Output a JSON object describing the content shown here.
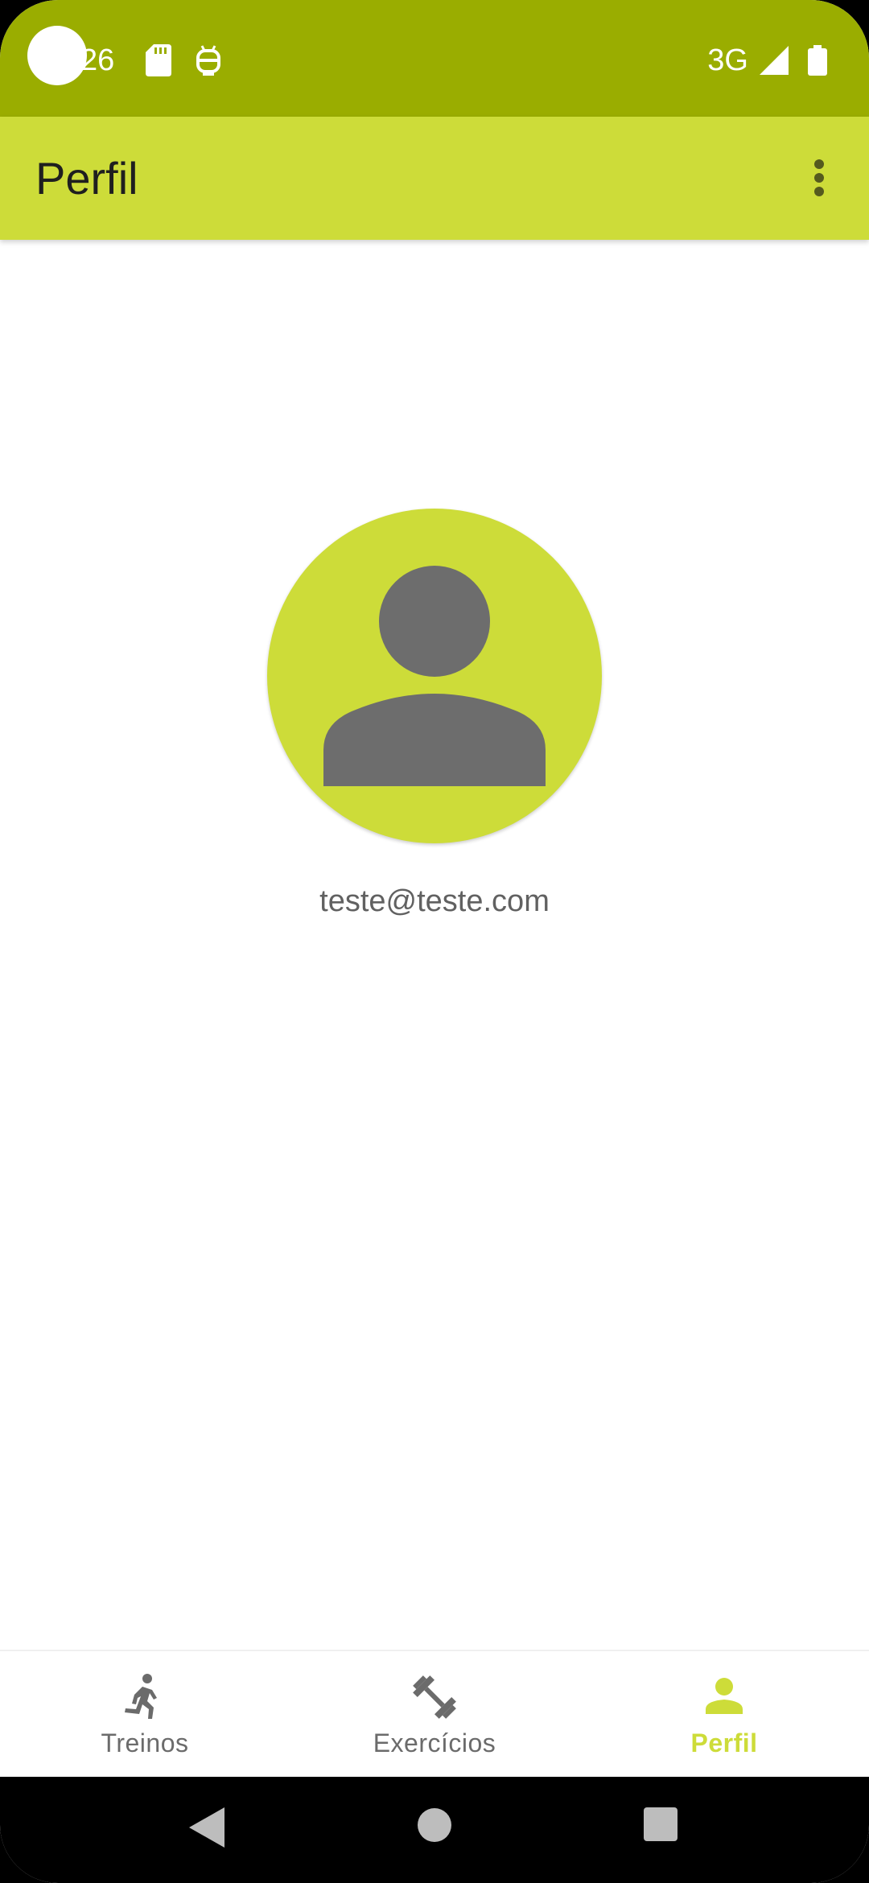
{
  "status_bar": {
    "time": "26",
    "network": "3G",
    "icons": [
      "sd-card-icon",
      "android-icon",
      "signal-icon",
      "battery-icon"
    ]
  },
  "app_bar": {
    "title": "Perfil",
    "menu_icon": "more-vert-icon"
  },
  "profile": {
    "avatar_icon": "person-icon",
    "email": "teste@teste.com"
  },
  "bottom_nav": {
    "items": [
      {
        "label": "Treinos",
        "icon": "run-icon",
        "active": false
      },
      {
        "label": "Exercícios",
        "icon": "dumbbell-icon",
        "active": false
      },
      {
        "label": "Perfil",
        "icon": "person-icon",
        "active": true
      }
    ]
  },
  "system_nav": {
    "icons": [
      "back-icon",
      "home-icon",
      "recents-icon"
    ]
  },
  "colors": {
    "status_bar": "#9aad00",
    "primary": "#cddc39",
    "icon_gray": "#6b6b6b"
  }
}
